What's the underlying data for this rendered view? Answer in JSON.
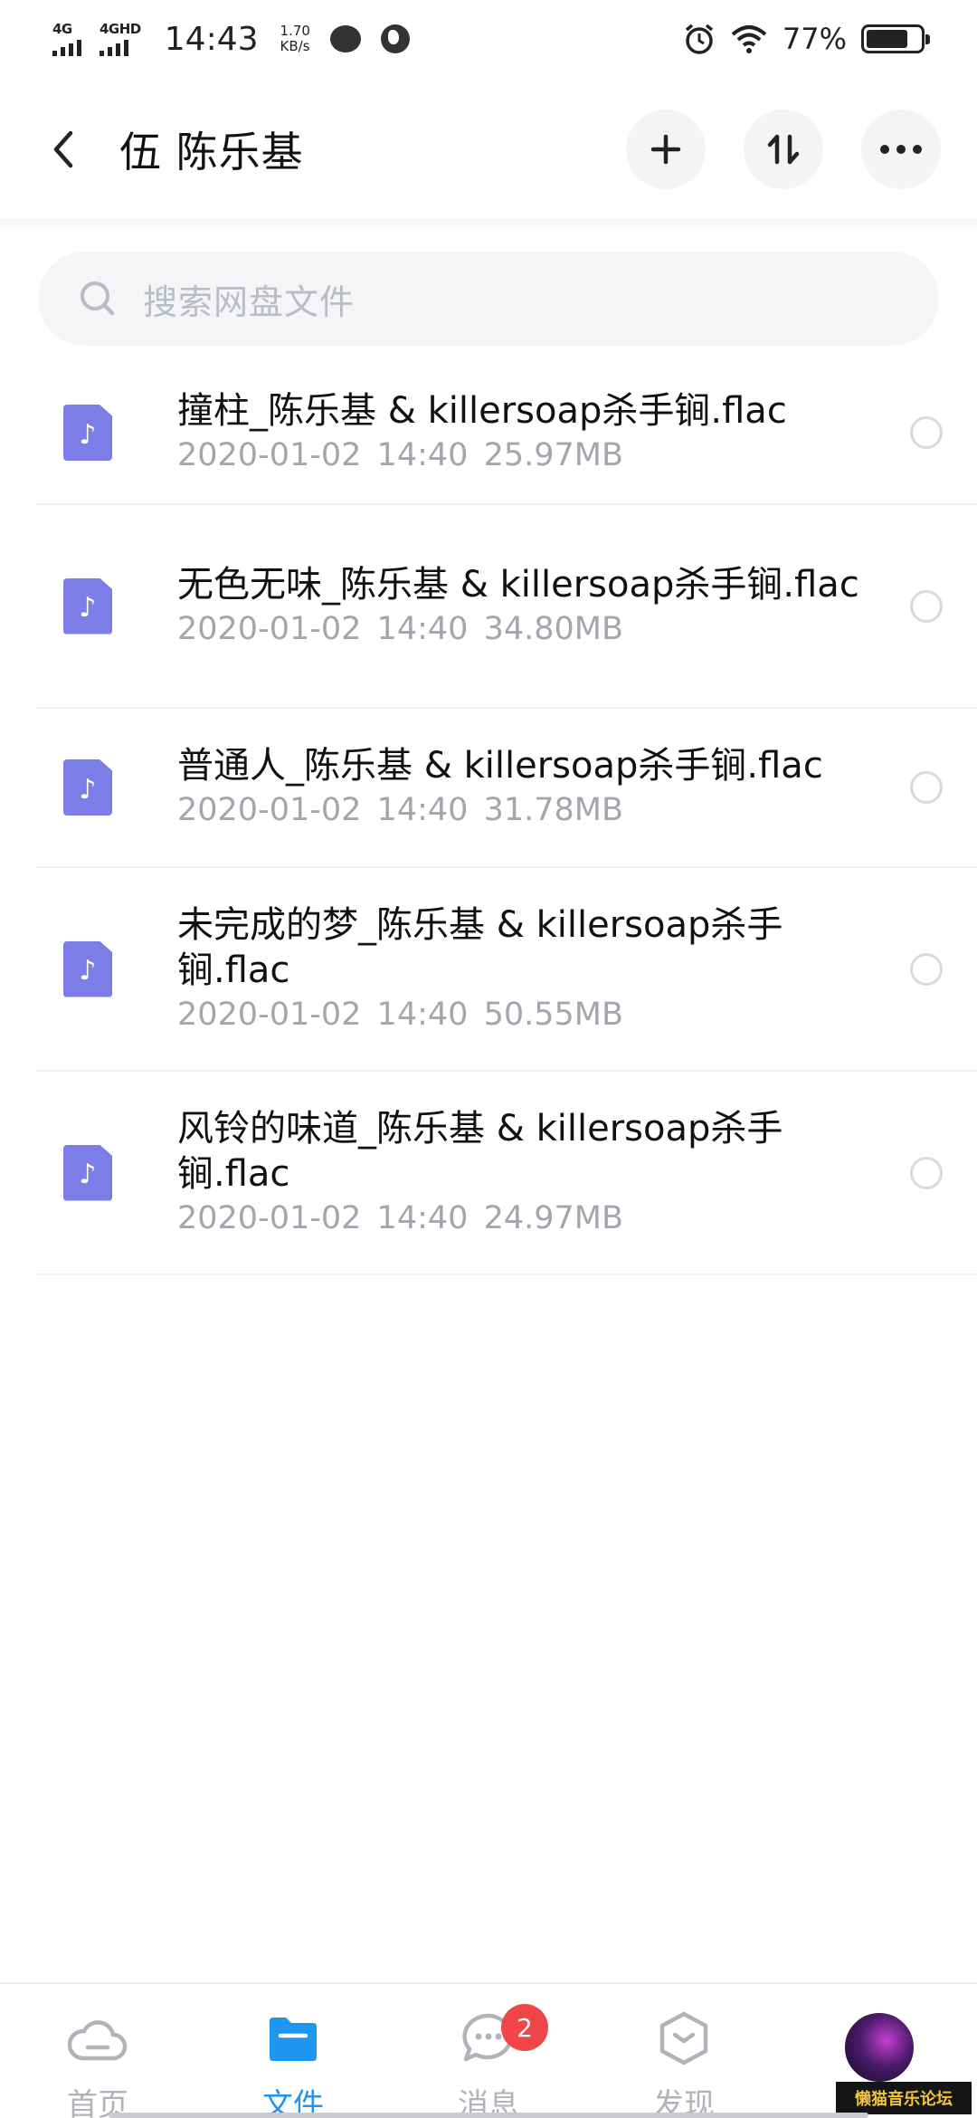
{
  "status_bar": {
    "signal1_label": "4G",
    "signal2_label": "4GHD",
    "time": "14:43",
    "speed_value": "1.70",
    "speed_unit": "KB/s",
    "battery_percent": "77%",
    "battery_level": 0.77
  },
  "header": {
    "title": "伍 陈乐基"
  },
  "search": {
    "placeholder": "搜索网盘文件"
  },
  "files": [
    {
      "name": "撞柱_陈乐基 & killersoap杀手锏.flac",
      "date": "2020-01-02",
      "time": "14:40",
      "size": "25.97MB"
    },
    {
      "name": "无色无味_陈乐基 & killersoap杀手锏.flac",
      "date": "2020-01-02",
      "time": "14:40",
      "size": "34.80MB"
    },
    {
      "name": "普通人_陈乐基 & killersoap杀手锏.flac",
      "date": "2020-01-02",
      "time": "14:40",
      "size": "31.78MB"
    },
    {
      "name": "未完成的梦_陈乐基 & killersoap杀手锏.flac",
      "date": "2020-01-02",
      "time": "14:40",
      "size": "50.55MB"
    },
    {
      "name": "风铃的味道_陈乐基 & killersoap杀手锏.flac",
      "date": "2020-01-02",
      "time": "14:40",
      "size": "24.97MB"
    }
  ],
  "bottom_nav": {
    "home": "首页",
    "files": "文件",
    "messages": "消息",
    "messages_badge": "2",
    "discover": "发现"
  },
  "watermark": "懒猫音乐论坛",
  "colors": {
    "accent": "#1e96f0",
    "file_icon": "#7b7ee6",
    "badge": "#f0464a"
  },
  "icons": {
    "back": "chevron-left-icon",
    "add": "plus-icon",
    "sort": "sort-icon",
    "more": "more-icon",
    "search": "search-icon",
    "file": "music-file-icon",
    "home": "cloud-icon",
    "files": "folder-icon",
    "messages": "chat-icon",
    "discover": "hexagon-icon"
  }
}
